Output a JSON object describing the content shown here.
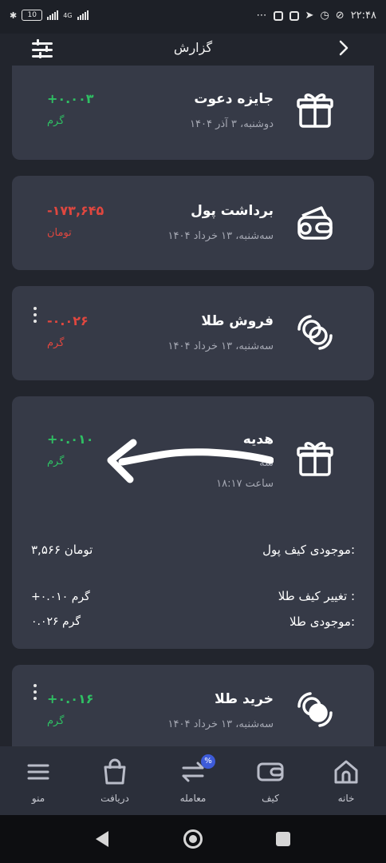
{
  "status_bar": {
    "time": "۲۲:۴۸",
    "battery": "10",
    "network": "4G"
  },
  "header": {
    "title": "گزارش",
    "back_icon": "chevron-right-icon",
    "filter_icon": "sliders-icon"
  },
  "transactions": [
    {
      "title": "جایزه دعوت",
      "date": "دوشنبه، ۳ آذر ۱۴۰۴",
      "amount": "+۰.۰۰۳",
      "unit": "گرم",
      "status": "positive",
      "icon": "gift-icon",
      "has_menu": false
    },
    {
      "title": "برداشت پول",
      "date": "سه‌شنبه، ۱۳ خرداد ۱۴۰۴",
      "amount": "-۱۷۳,۶۴۵",
      "unit": "تومان",
      "status": "negative",
      "icon": "wallet-icon",
      "has_menu": false
    },
    {
      "title": "فروش طلا",
      "date": "سه‌شنبه، ۱۳ خرداد ۱۴۰۴",
      "amount": "-۰.۰۲۶",
      "unit": "گرم",
      "status": "negative",
      "icon": "exchange-coins-icon",
      "has_menu": true
    },
    {
      "title": "هدیه",
      "date": "سه",
      "time": "ساعت ۱۸:۱۷",
      "amount": "+۰.۰۱۰",
      "unit": "گرم",
      "status": "positive",
      "icon": "gift-icon",
      "has_menu": false,
      "details": {
        "wallet_balance_label": "موجودی کیف پول:",
        "wallet_balance_value": "۳,۵۶۶ تومان",
        "gold_change_label": "تغییر کیف طلا :",
        "gold_change_value": "+۰.۰۱۰ گرم",
        "gold_balance_label": "موجودی طلا:",
        "gold_balance_value": "۰.۰۲۶ گرم"
      }
    },
    {
      "title": "خرید طلا",
      "date": "سه‌شنبه، ۱۳ خرداد ۱۴۰۴",
      "amount": "+۰.۰۱۶",
      "unit": "گرم",
      "status": "positive",
      "icon": "exchange-coins-icon",
      "has_menu": true
    }
  ],
  "bottom_nav": [
    {
      "label": "خانه",
      "icon": "home-icon"
    },
    {
      "label": "کیف",
      "icon": "wallet-icon"
    },
    {
      "label": "معامله",
      "icon": "swap-arrows-icon",
      "badge": "%"
    },
    {
      "label": "دریافت",
      "icon": "shopping-bag-icon"
    },
    {
      "label": "منو",
      "icon": "menu-icon"
    }
  ],
  "colors": {
    "background": "#22252d",
    "card": "#363a47",
    "positive": "#2fbf63",
    "negative": "#e0473f",
    "accent": "#3d5bd8"
  }
}
